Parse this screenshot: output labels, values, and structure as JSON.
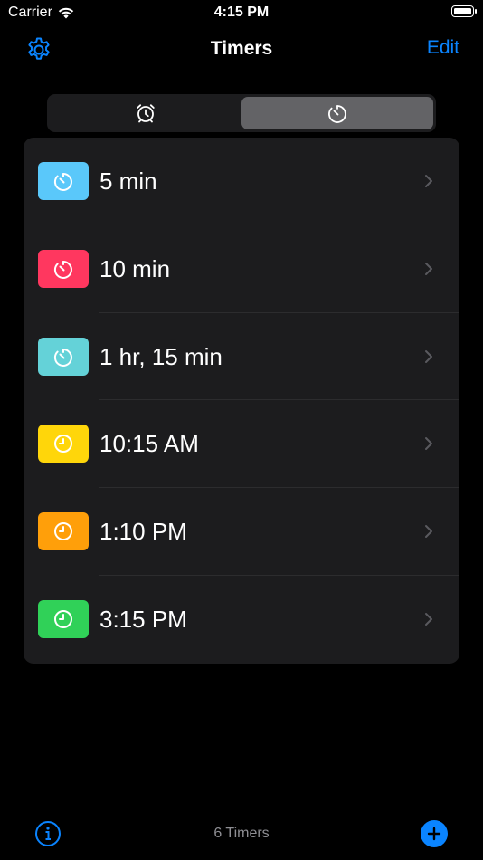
{
  "status_bar": {
    "carrier": "Carrier",
    "time": "4:15 PM"
  },
  "nav": {
    "title": "Timers",
    "edit_label": "Edit"
  },
  "segments": [
    {
      "icon": "alarm-clock-icon",
      "selected": false
    },
    {
      "icon": "timer-icon",
      "selected": true
    }
  ],
  "timers": [
    {
      "label": "5 min",
      "color": "#5ac8fa",
      "icon": "timer-icon"
    },
    {
      "label": "10 min",
      "color": "#ff375f",
      "icon": "timer-icon"
    },
    {
      "label": "1 hr, 15 min",
      "color": "#64d2d8",
      "icon": "timer-icon"
    },
    {
      "label": "10:15 AM",
      "color": "#ffd60a",
      "icon": "clock-icon"
    },
    {
      "label": "1:10 PM",
      "color": "#ff9f0a",
      "icon": "clock-icon"
    },
    {
      "label": "3:15 PM",
      "color": "#30d158",
      "icon": "clock-icon"
    }
  ],
  "toolbar": {
    "count_label": "6 Timers"
  },
  "colors": {
    "accent": "#0a84ff",
    "background": "#000000",
    "card": "#1c1c1e"
  }
}
